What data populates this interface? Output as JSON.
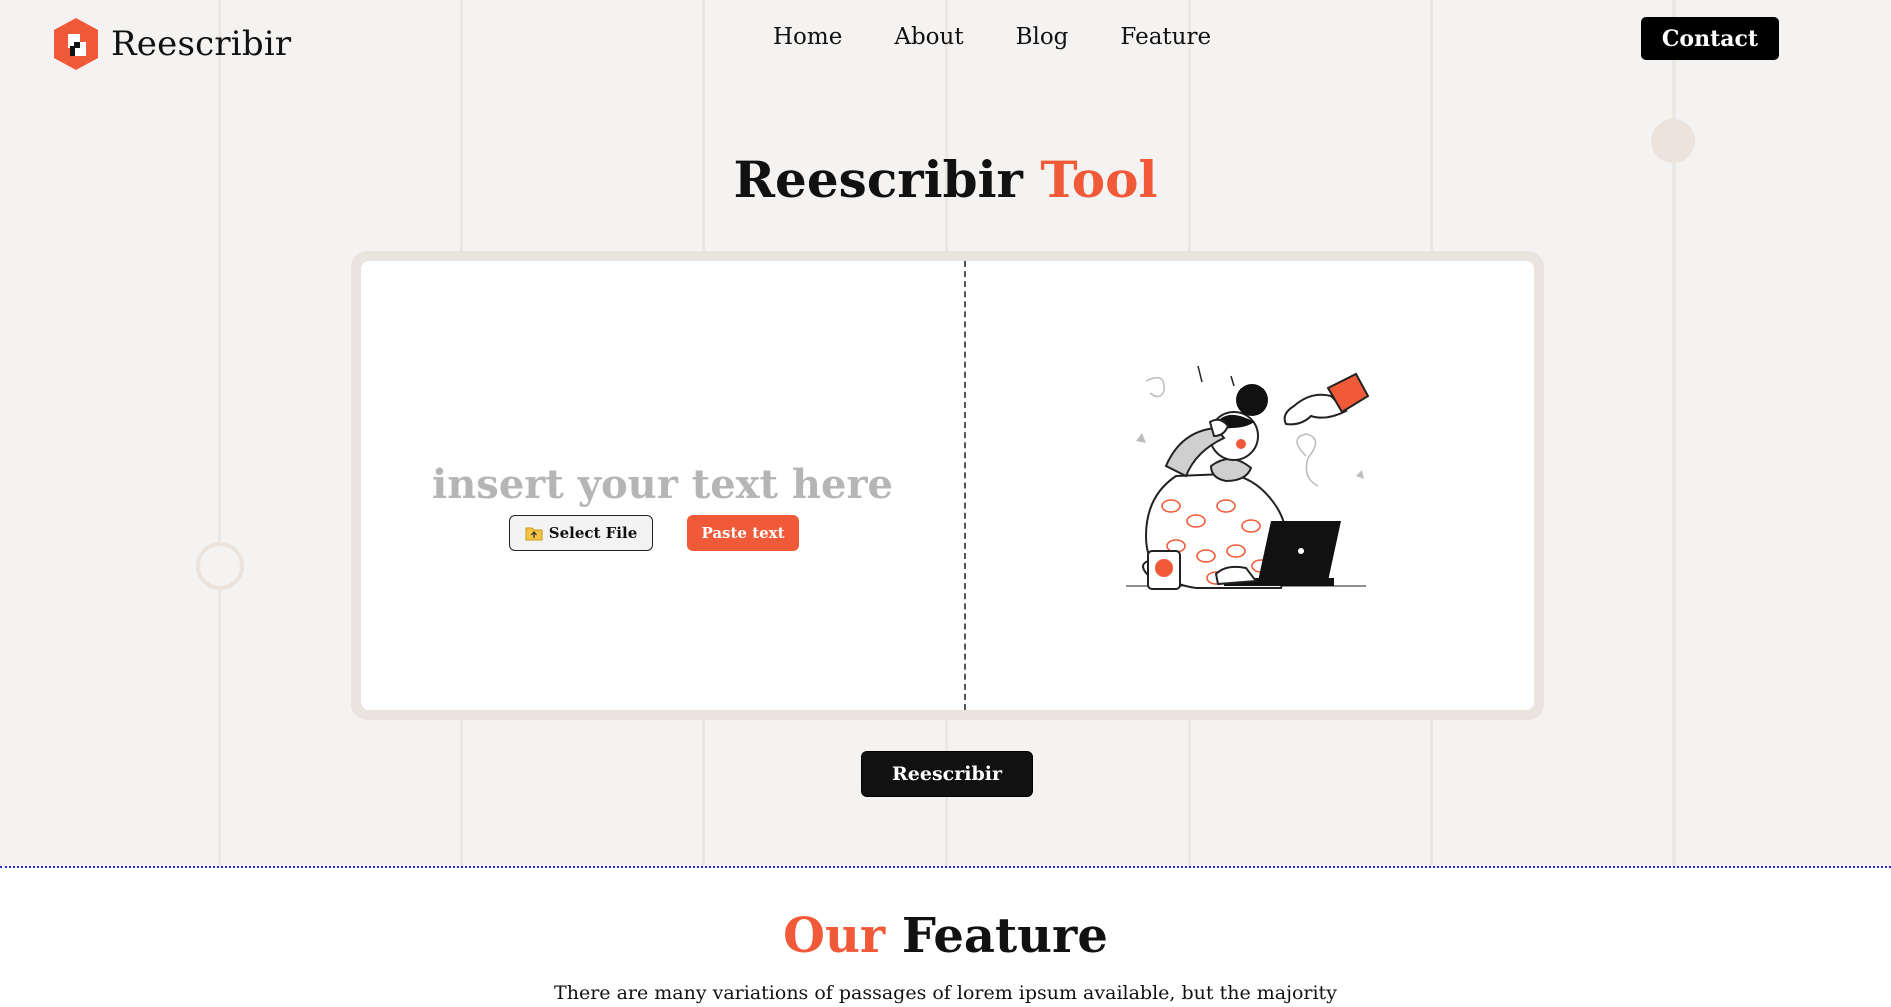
{
  "brand": {
    "name": "Reescribir"
  },
  "nav": {
    "items": [
      "Home",
      "About",
      "Blog",
      "Feature"
    ],
    "contact_label": "Contact"
  },
  "hero": {
    "title_main": "Reescribir",
    "title_accent": "Tool"
  },
  "editor": {
    "placeholder": "insert your text here",
    "select_file_label": "Select File",
    "paste_label": "Paste text",
    "illustration": "person-at-laptop-illustration"
  },
  "action": {
    "rewrite_label": "Reescribir"
  },
  "feature": {
    "title_accent": "Our",
    "title_main": "Feature",
    "description": "There are many variations of passages of lorem ipsum available, but the majority"
  },
  "colors": {
    "accent": "#f05a38",
    "dark": "#111111",
    "background": "#f4f3f1",
    "panel_border": "#e9e4de"
  }
}
